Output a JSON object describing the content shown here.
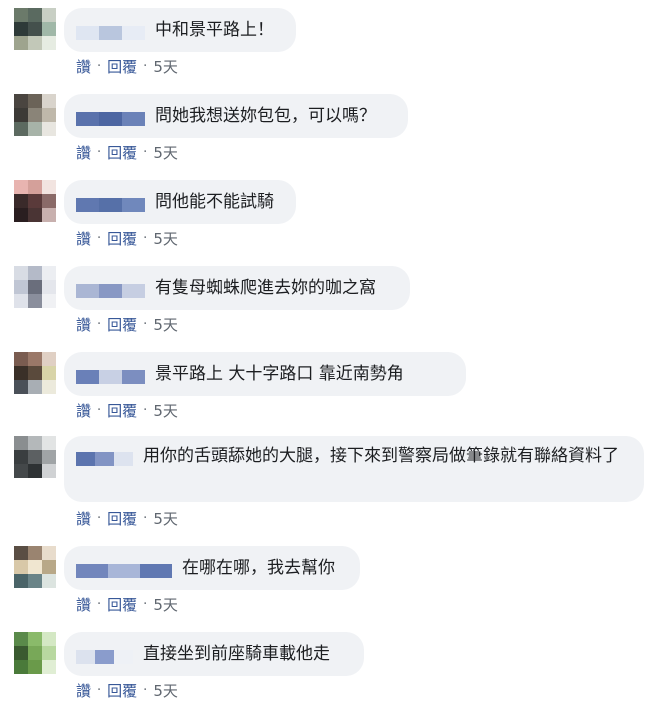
{
  "comments": [
    {
      "text": "中和景平路上！",
      "actions": {
        "like": "讚",
        "reply": "回覆",
        "separator": "·",
        "time": "5天"
      },
      "avatar_colors": [
        "#6b7a6a",
        "#5a6a60",
        "#c8cfc4",
        "#2e3a38",
        "#44504c",
        "#a0b8a8",
        "#9ea48e",
        "#c2c8b8",
        "#e6ece2"
      ],
      "name_colors": [
        "#dfe6f2",
        "#b9c6de",
        "#e7ecf5"
      ]
    },
    {
      "text": "問她我想送妳包包，可以嗎？",
      "actions": {
        "like": "讚",
        "reply": "回覆",
        "separator": "·",
        "time": "5天"
      },
      "avatar_colors": [
        "#4a4540",
        "#6b6358",
        "#d9d4cc",
        "#3c3a36",
        "#8a8478",
        "#bfb8aa",
        "#5c6a60",
        "#a7b3a8",
        "#e8e6e0"
      ],
      "name_colors": [
        "#5a72ac",
        "#4d66a2",
        "#6b82b8"
      ]
    },
    {
      "text": "問他能不能試騎",
      "actions": {
        "like": "讚",
        "reply": "回覆",
        "separator": "·",
        "time": "5天"
      },
      "avatar_colors": [
        "#e8b4b0",
        "#d4a09a",
        "#f2e4e0",
        "#3a2a2a",
        "#5a3a3a",
        "#8a6a68",
        "#2a1e20",
        "#4a3434",
        "#c8b0ae"
      ],
      "name_colors": [
        "#6078b0",
        "#5670a8",
        "#7088bc"
      ]
    },
    {
      "text": "有隻母蜘蛛爬進去妳的咖之窩",
      "actions": {
        "like": "讚",
        "reply": "回覆",
        "separator": "·",
        "time": "5天"
      },
      "avatar_colors": [
        "#d8dce4",
        "#b4bac8",
        "#eceef2",
        "#c0c6d4",
        "#6a6e7c",
        "#e4e6ec",
        "#dfe2ea",
        "#8a8e9c",
        "#f0f1f4"
      ],
      "name_colors": [
        "#aab6d4",
        "#8898c4",
        "#c6cee2"
      ]
    },
    {
      "text": "景平路上 大十字路口 靠近南勢角",
      "actions": {
        "like": "讚",
        "reply": "回覆",
        "separator": "·",
        "time": "5天"
      },
      "avatar_colors": [
        "#7a5c50",
        "#9a7868",
        "#e0d0c4",
        "#3a3028",
        "#5a4a3c",
        "#d8d4a8",
        "#4a5058",
        "#a8aeb4",
        "#eceadc"
      ],
      "name_colors": [
        "#6a80b8",
        "#c8d0e4",
        "#7c8ec0"
      ]
    },
    {
      "text": "用你的舌頭舔她的大腿，接下來到警察局做筆錄就有聯絡資料了",
      "actions": {
        "like": "讚",
        "reply": "回覆",
        "separator": "·",
        "time": "5天"
      },
      "avatar_colors": [
        "#8a8e90",
        "#b4b8ba",
        "#e2e4e4",
        "#3a3e40",
        "#5c6062",
        "#a0a4a6",
        "#44484a",
        "#2e3234",
        "#d0d2d4"
      ],
      "name_colors": [
        "#5c74ae",
        "#8294c4",
        "#dde3ef"
      ]
    },
    {
      "text": "在哪在哪，我去幫你",
      "actions": {
        "like": "讚",
        "reply": "回覆",
        "separator": "·",
        "time": "5天"
      },
      "avatar_colors": [
        "#5a4e44",
        "#9a8470",
        "#e8dccc",
        "#d8c8a8",
        "#f0e6d0",
        "#b8a888",
        "#4a6468",
        "#6a8488",
        "#dce4e0"
      ],
      "name_colors": [
        "#7286bc",
        "#a8b6d8",
        "#6078b2"
      ]
    },
    {
      "text": "直接坐到前座騎車載他走",
      "actions": {
        "like": "讚",
        "reply": "回覆",
        "separator": "·",
        "time": "5天"
      },
      "avatar_colors": [
        "#5a8a4a",
        "#8aba6a",
        "#d4e8c4",
        "#3a5a30",
        "#78a858",
        "#b8d8a0",
        "#4a7a3a",
        "#6a9a4a",
        "#e0eed4"
      ],
      "name_colors": [
        "#dce2ee",
        "#8a9ccc",
        "#eef1f6"
      ]
    }
  ]
}
